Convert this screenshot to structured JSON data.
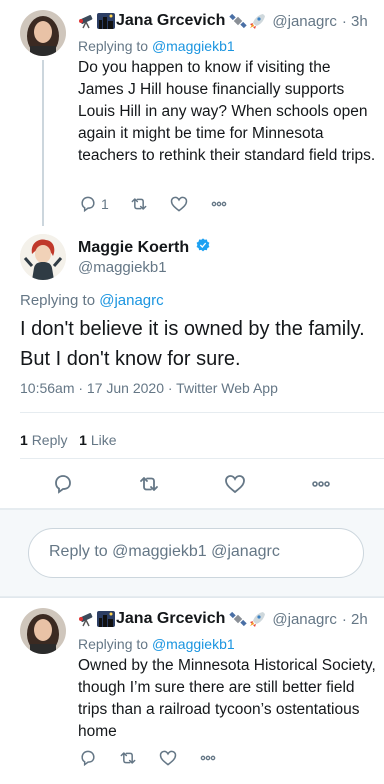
{
  "tweet1": {
    "name": "Jana Grcevich",
    "handle": "@janagrc",
    "time": "3h",
    "replying_prefix": "Replying to",
    "replying_to": "@maggiekb1",
    "text": "Do you happen to know if visiting the James J Hill house financially supports Louis Hill in any way? When schools open again it might be time for Minnesota teachers to rethink their standard field trips.",
    "reply_count": "1",
    "icons": [
      "telescope-icon",
      "night-city-icon",
      "satellite-icon",
      "rocket-icon"
    ]
  },
  "tweet2": {
    "name": "Maggie Koerth",
    "handle": "@maggiekb1",
    "replying_prefix": "Replying to",
    "replying_to": "@janagrc",
    "text": "I don't believe it is owned by the family. But I don't know for sure.",
    "meta": "10:56am · 17 Jun 2020 · Twitter Web App",
    "reply_count": "1",
    "reply_label": "Reply",
    "like_count": "1",
    "like_label": "Like"
  },
  "reply_box": {
    "placeholder": "Reply to @maggiekb1 @janagrc"
  },
  "tweet3": {
    "name": "Jana Grcevich",
    "handle": "@janagrc",
    "time": "2h",
    "replying_prefix": "Replying to",
    "replying_to": "@maggiekb1",
    "text": "Owned by the Minnesota Historical Society, though I’m sure there are still better field trips than a railroad tycoon’s ostentatious home"
  },
  "colors": {
    "accent": "#1b95e0",
    "muted": "#657786",
    "background": "#e6ecf0"
  }
}
